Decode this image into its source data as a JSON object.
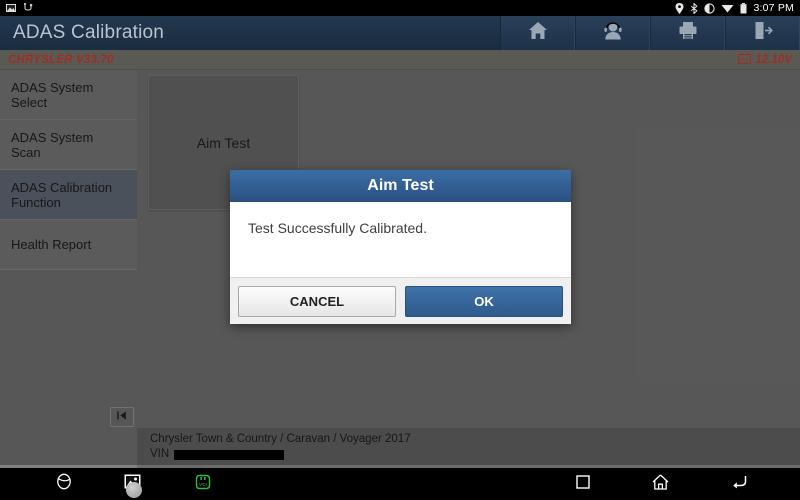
{
  "status_bar": {
    "left_icons": [
      "screenshot-icon",
      "usb-icon"
    ],
    "right_icons": [
      "location-pin-icon",
      "bluetooth-icon",
      "brightness-icon",
      "wifi-icon",
      "battery-icon"
    ],
    "time": "3:07 PM"
  },
  "header": {
    "title": "ADAS Calibration",
    "buttons": [
      {
        "name": "home-button",
        "icon": "home-icon"
      },
      {
        "name": "support-button",
        "icon": "headset-person-icon"
      },
      {
        "name": "print-button",
        "icon": "printer-icon"
      },
      {
        "name": "exit-button",
        "icon": "exit-door-icon"
      }
    ]
  },
  "subbar": {
    "version": "CHRYSLER V33.70",
    "voltage": "12.10V",
    "battery_icon": "battery-voltage-icon"
  },
  "sidebar": {
    "items": [
      {
        "label": "ADAS System Select",
        "active": false
      },
      {
        "label": "ADAS System Scan",
        "active": false
      },
      {
        "label": "ADAS Calibration Function",
        "active": true
      },
      {
        "label": "Health Report",
        "active": false
      }
    ],
    "collapse_button": {
      "icon": "collapse-left-icon",
      "glyph": "❘◀"
    }
  },
  "main": {
    "tiles": [
      {
        "label": "Aim Test"
      }
    ]
  },
  "vehicle_info": {
    "name": "Chrysler Town & Country / Caravan / Voyager 2017",
    "vin_label": "VIN",
    "vin_value": ""
  },
  "dialog": {
    "title": "Aim Test",
    "message": "Test Successfully Calibrated.",
    "cancel_label": "CANCEL",
    "ok_label": "OK"
  },
  "nav_bar": {
    "left": [
      {
        "name": "browser-button",
        "icon": "globe-icon"
      },
      {
        "name": "gallery-button",
        "icon": "image-icon"
      },
      {
        "name": "vci-button",
        "icon": "vci-connector-icon"
      }
    ],
    "right": [
      {
        "name": "recents-button",
        "icon": "square-icon"
      },
      {
        "name": "home-button",
        "icon": "home-outline-icon"
      },
      {
        "name": "back-button",
        "icon": "back-arrow-icon"
      }
    ]
  },
  "colors": {
    "header_navy": "#1c3048",
    "accent_blue": "#2f5a8c",
    "warn_red": "#c0392b",
    "surface_gray": "#6b6b6b",
    "active_item": "#5b6370",
    "vci_green": "#2fbf3f"
  }
}
